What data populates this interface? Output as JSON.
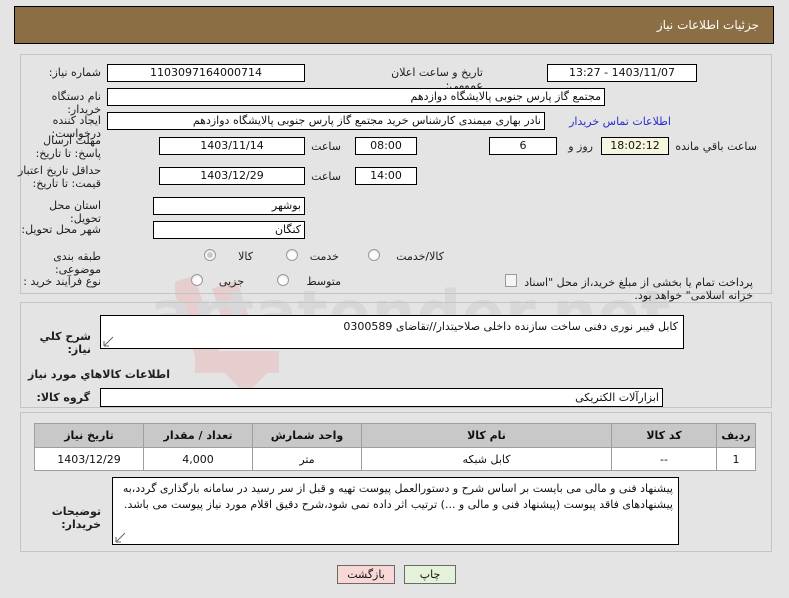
{
  "header": {
    "title": "جزئیات اطلاعات نیاز"
  },
  "watermark": {
    "text": "artatender.net"
  },
  "main": {
    "labels": {
      "need_number": "شماره نیاز:",
      "buyer_org": "نام دستگاه خریدار:",
      "request_creator": "ایجاد کننده درخواست:",
      "response_deadline": "مهلت ارسال پاسخ: تا تاریخ:",
      "price_validity": "حداقل تاریخ اعتبار قیمت: تا تاریخ:",
      "delivery_province": "استان محل تحویل:",
      "delivery_city": "شهر محل تحویل:",
      "subject_category": "طبقه بندی موضوعی:",
      "purchase_process": "نوع فرآیند خرید :",
      "public_announce": "تاریخ و ساعت اعلان عمومی:",
      "hour_1": "ساعت",
      "hour_2": "ساعت",
      "day_and": "روز و",
      "remaining": "ساعت باقي مانده",
      "contact_link": "اطلاعات تماس خریدار"
    },
    "values": {
      "need_number": "1103097164000714",
      "buyer_org": "مجتمع گاز پارس جنوبی  پالایشگاه دوازدهم",
      "request_creator": "نادر بهاری میمندی کارشناس خرید مجتمع گاز پارس جنوبی  پالایشگاه دوازدهم",
      "public_announce": "1403/11/07 - 13:27",
      "response_deadline_date": "1403/11/14",
      "response_deadline_time": "08:00",
      "remaining_days": "6",
      "remaining_time": "18:02:12",
      "price_validity_date": "1403/12/29",
      "price_validity_time": "14:00",
      "delivery_province": "بوشهر",
      "delivery_city": "کنگان"
    },
    "subject_category_options": [
      {
        "label": "کالا",
        "selected": true
      },
      {
        "label": "خدمت",
        "selected": false
      },
      {
        "label": "کالا/خدمت",
        "selected": false
      }
    ],
    "purchase_process_options": [
      {
        "label": "جزیی",
        "selected": false
      },
      {
        "label": "متوسط",
        "selected": false
      }
    ],
    "treasury_checkbox": {
      "label": "پرداخت تمام یا بخشی از مبلغ خرید،از محل \"اسناد خزانه اسلامی\" خواهد بود.",
      "checked": false
    }
  },
  "description": {
    "label": "شرح كلي نياز:",
    "value": "کابل فیبر نوری دفنی ساخت سازنده داخلی صلاحیتدار//تقاضای 0300589"
  },
  "goods_section": {
    "heading": "اطلاعات كالاهاي مورد نياز",
    "group_label": "گروه کالا:",
    "group_value": "ابزارآلات الکتریکی"
  },
  "items_table": {
    "headers": [
      "ردیف",
      "کد کالا",
      "نام کالا",
      "واحد شمارش",
      "تعداد / مقدار",
      "تاریخ نیاز"
    ],
    "rows": [
      [
        "1",
        "--",
        "کابل شبکه",
        "متر",
        "4,000",
        "1403/12/29"
      ]
    ]
  },
  "buyer_notes": {
    "label": "توضیحات خریدار:",
    "value": "پیشنهاد فنی و مالی می بایست بر اساس شرح و دستورالعمل پیوست تهیه و قبل از سر رسید در سامانه بارگذاری گردد،به پیشنهادهای فاقد پیوست (پیشنهاد فنی و مالی و ...) ترتیب اثر داده نمی شود،شرح دقیق اقلام مورد نیاز پیوست می باشد."
  },
  "footer": {
    "back_button": "بازگشت",
    "print_button": "چاپ"
  },
  "colors": {
    "header_bar": "#8c6e45",
    "back_button": "#f8d7d7",
    "print_button": "#e4f2da",
    "timer_field": "#f7f7e0",
    "link": "#2b2bd0",
    "page_bg": "#e4e4e4"
  }
}
